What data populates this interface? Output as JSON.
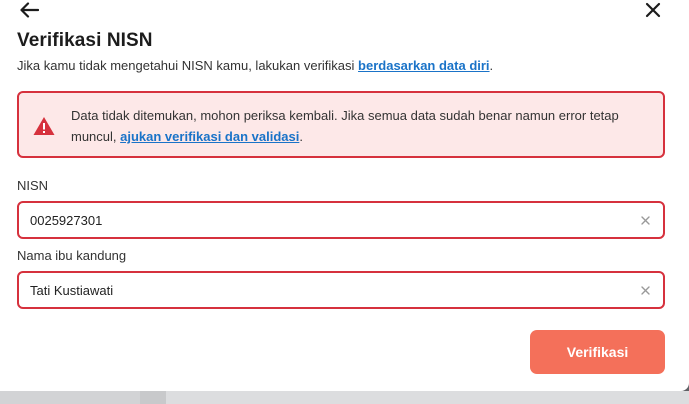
{
  "dialog": {
    "back_icon": "arrow-left-icon",
    "close_icon": "close-icon",
    "title": "Verifikasi NISN",
    "subtitle_text": "Jika kamu tidak mengetahui NISN kamu, lakukan verifikasi ",
    "subtitle_link": "berdasarkan data diri",
    "subtitle_end": "."
  },
  "alert": {
    "icon": "warning-triangle-icon",
    "text": "Data tidak ditemukan, mohon periksa kembali. Jika semua data sudah benar namun error tetap muncul, ",
    "link": "ajukan verifikasi dan validasi",
    "end": ".",
    "color": "#d6313d",
    "background": "#fde8e8"
  },
  "form": {
    "nisn_label": "NISN",
    "nisn_value": "0025927301",
    "mother_label": "Nama ibu kandung",
    "mother_value": "Tati Kustiawati",
    "clear_icon": "clear-x-icon",
    "submit_label": "Verifikasi"
  },
  "colors": {
    "accent": "#f4705a",
    "link": "#1a73c8",
    "error": "#d6313d"
  }
}
